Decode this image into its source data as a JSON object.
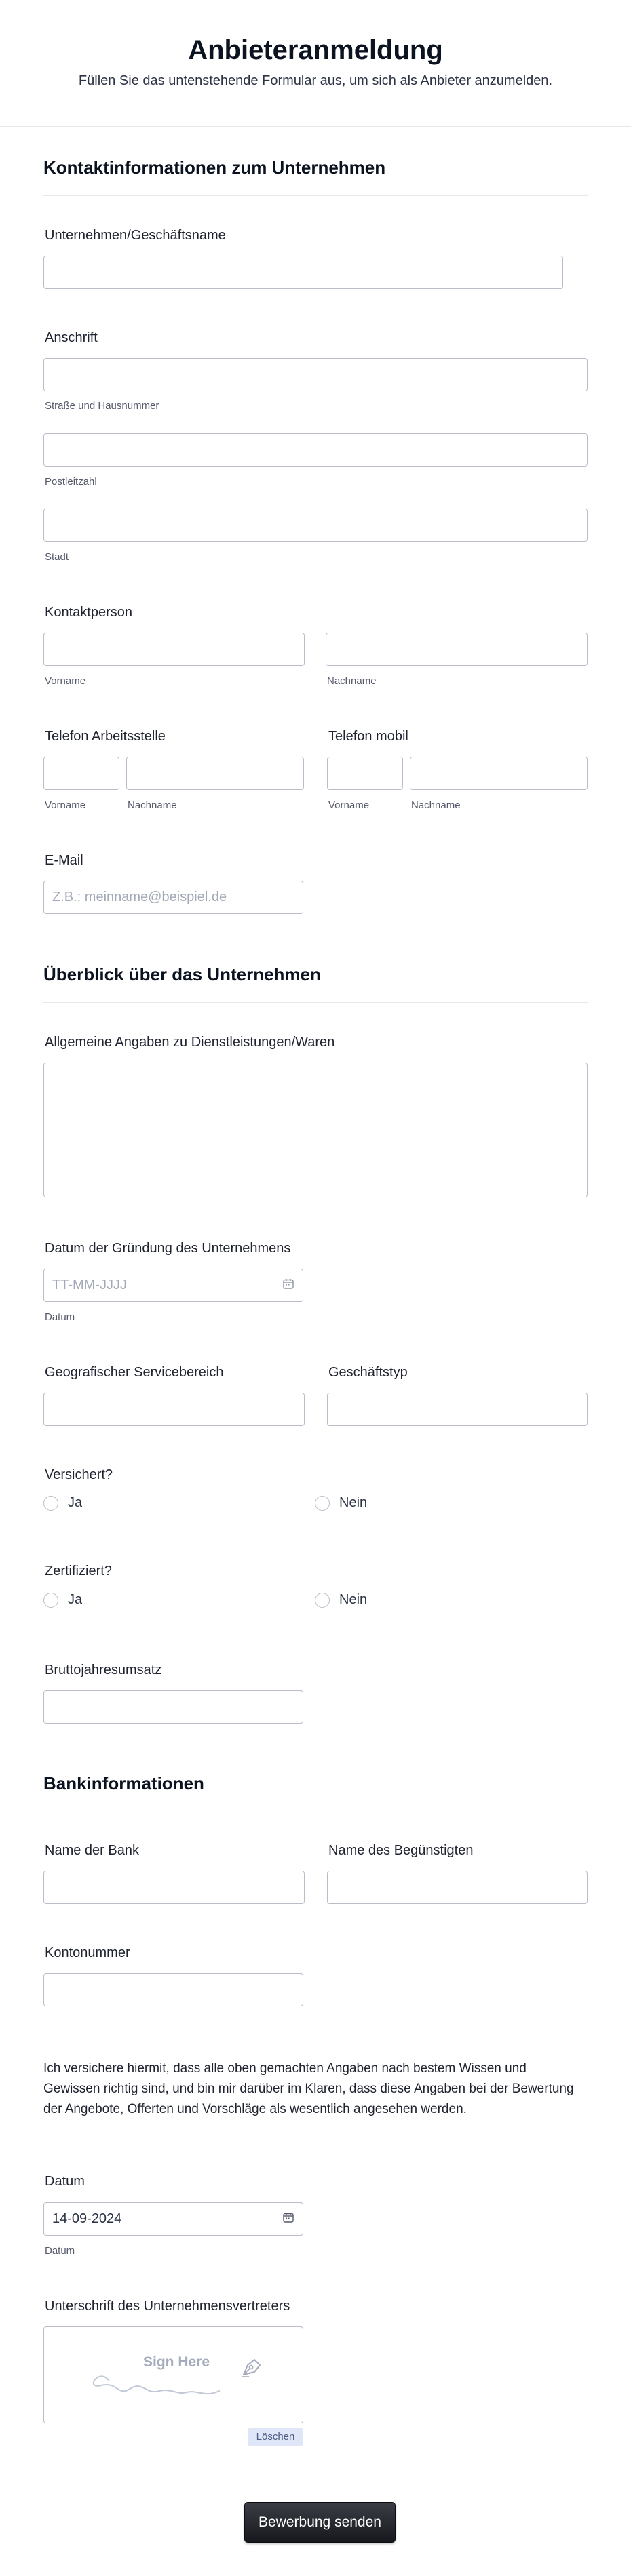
{
  "form": {
    "title": "Anbieteranmeldung",
    "subtitle": "Füllen Sie das untenstehende Formular aus, um sich als Anbieter anzumelden."
  },
  "sections": {
    "contact": "Kontaktinformationen zum Unternehmen",
    "overview": "Überblick über das Unternehmen",
    "bank": "Bankinformationen"
  },
  "fields": {
    "company_name": {
      "label": "Unternehmen/Geschäftsname",
      "value": ""
    },
    "address": {
      "label": "Anschrift",
      "street_sub": "Straße und Hausnummer",
      "zip_sub": "Postleitzahl",
      "city_sub": "Stadt"
    },
    "contact_person": {
      "label": "Kontaktperson",
      "first_sub": "Vorname",
      "last_sub": "Nachname"
    },
    "phone_work": {
      "label": "Telefon Arbeitsstelle",
      "first_sub": "Vorname",
      "last_sub": "Nachname"
    },
    "phone_mobile": {
      "label": "Telefon mobil",
      "first_sub": "Vorname",
      "last_sub": "Nachname"
    },
    "email": {
      "label": "E-Mail",
      "placeholder": "Z.B.: meinname@beispiel.de"
    },
    "general_info": {
      "label": "Allgemeine Angaben zu Dienstleistungen/Waren"
    },
    "founding_date": {
      "label": "Datum der Gründung des Unternehmens",
      "placeholder": "TT-MM-JJJJ",
      "sub": "Datum"
    },
    "service_area": {
      "label": "Geografischer Servicebereich"
    },
    "business_type": {
      "label": "Geschäftstyp"
    },
    "insured": {
      "label": "Versichert?",
      "yes": "Ja",
      "no": "Nein"
    },
    "certified": {
      "label": "Zertifiziert?",
      "yes": "Ja",
      "no": "Nein"
    },
    "revenue": {
      "label": "Bruttojahresumsatz"
    },
    "bank_name": {
      "label": "Name der Bank"
    },
    "beneficiary": {
      "label": "Name des Begünstigten"
    },
    "account": {
      "label": "Kontonummer"
    },
    "declaration": "Ich versichere hiermit, dass alle oben gemachten Angaben nach bestem Wissen und Gewissen richtig sind, und bin mir darüber im Klaren, dass diese Angaben bei der Bewertung der Angebote, Offerten und Vorschläge als wesentlich angesehen werden.",
    "date": {
      "label": "Datum",
      "value": "14-09-2024",
      "sub": "Datum"
    },
    "signature": {
      "label": "Unterschrift des Unternehmensvertreters",
      "placeholder": "Sign Here",
      "clear": "Löschen"
    }
  },
  "submit_label": "Bewerbung senden",
  "icons": {
    "calendar": "calendar-icon",
    "signature": "pen-nib-icon"
  },
  "colors": {
    "border": "#b8bdc9",
    "clear_bg": "#dfe6f7",
    "submit_bg": "#1f2127"
  }
}
